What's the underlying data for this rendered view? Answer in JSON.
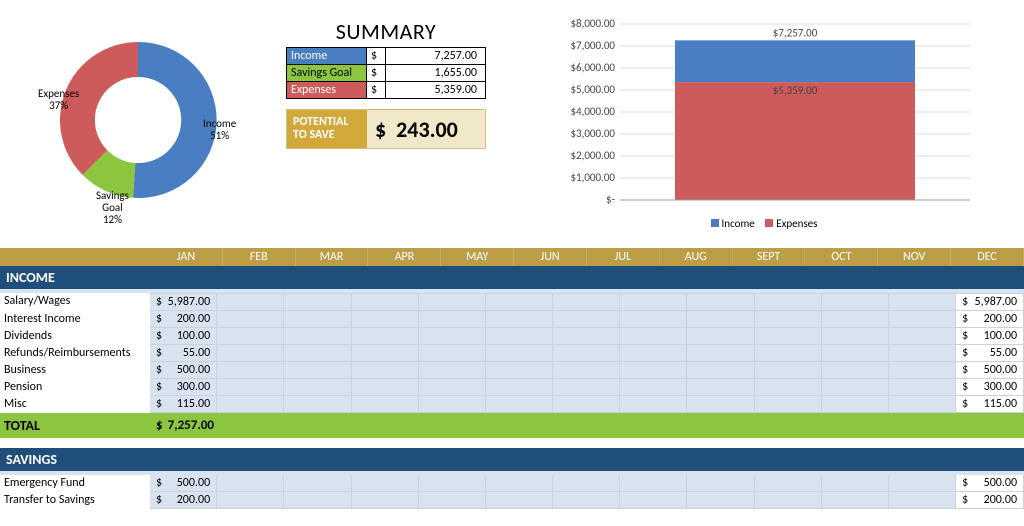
{
  "summary": {
    "title": "SUMMARY",
    "rows": {
      "income": {
        "label": "Income",
        "currency": "$",
        "value": "7,257.00"
      },
      "savings": {
        "label": "Savings Goal",
        "currency": "$",
        "value": "1,655.00"
      },
      "expenses": {
        "label": "Expenses",
        "currency": "$",
        "value": "5,359.00"
      }
    },
    "potential": {
      "label": "POTENTIAL TO SAVE",
      "currency": "$",
      "value": "243.00"
    }
  },
  "donut": {
    "labels": {
      "income": {
        "line1": "Income",
        "line2": "51%"
      },
      "expenses": {
        "line1": "Expenses",
        "line2": "37%"
      },
      "savings": {
        "line1": "Savings",
        "line2": "Goal",
        "line3": "12%"
      }
    }
  },
  "bar": {
    "top_label": "$7,257.00",
    "mid_label": "$5,359.00",
    "yticks": [
      "$8,000.00",
      "$7,000.00",
      "$6,000.00",
      "$5,000.00",
      "$4,000.00",
      "$3,000.00",
      "$2,000.00",
      "$1,000.00",
      "$-"
    ],
    "legend": {
      "income": "Income",
      "expenses": "Expenses"
    }
  },
  "months": [
    "JAN",
    "FEB",
    "MAR",
    "APR",
    "MAY",
    "JUN",
    "JUL",
    "AUG",
    "SEPT",
    "OCT",
    "NOV",
    "DEC"
  ],
  "sections": {
    "income": {
      "title": "INCOME",
      "rows": [
        {
          "label": "Salary/Wages",
          "jan": "5,987.00",
          "total": "5,987.00"
        },
        {
          "label": "Interest Income",
          "jan": "200.00",
          "total": "200.00"
        },
        {
          "label": "Dividends",
          "jan": "100.00",
          "total": "100.00"
        },
        {
          "label": "Refunds/Reimbursements",
          "jan": "55.00",
          "total": "55.00"
        },
        {
          "label": "Business",
          "jan": "500.00",
          "total": "500.00"
        },
        {
          "label": "Pension",
          "jan": "300.00",
          "total": "300.00"
        },
        {
          "label": "Misc",
          "jan": "115.00",
          "total": "115.00"
        }
      ],
      "total": {
        "label": "TOTAL",
        "currency": "$",
        "value": "7,257.00"
      }
    },
    "savings": {
      "title": "SAVINGS",
      "rows": [
        {
          "label": "Emergency Fund",
          "jan": "500.00",
          "total": "500.00"
        },
        {
          "label": "Transfer to Savings",
          "jan": "200.00",
          "total": "200.00"
        }
      ]
    }
  },
  "colors": {
    "income": "#4a7ec2",
    "expenses": "#cd5b5b",
    "savings": "#8cc63e",
    "header_dark": "#1f4e7a",
    "gold": "#bb9e46"
  },
  "chart_data": [
    {
      "type": "pie",
      "title": "",
      "series": [
        {
          "name": "Income",
          "value": 51,
          "color": "#4a7ec2"
        },
        {
          "name": "Expenses",
          "value": 37,
          "color": "#cd5b5b"
        },
        {
          "name": "Savings Goal",
          "value": 12,
          "color": "#8cc63e"
        }
      ],
      "inner_radius_pct": 55
    },
    {
      "type": "bar",
      "stacked": true,
      "categories": [
        ""
      ],
      "series": [
        {
          "name": "Expenses",
          "values": [
            5359.0
          ],
          "color": "#cd5b5b"
        },
        {
          "name": "Income",
          "values": [
            1898.0
          ],
          "color": "#4a7ec2"
        }
      ],
      "data_labels": [
        7257.0,
        5359.0
      ],
      "ylabel": "",
      "ylim": [
        0,
        8000
      ],
      "yticks": [
        0,
        1000,
        2000,
        3000,
        4000,
        5000,
        6000,
        7000,
        8000
      ],
      "legend_position": "bottom"
    }
  ]
}
